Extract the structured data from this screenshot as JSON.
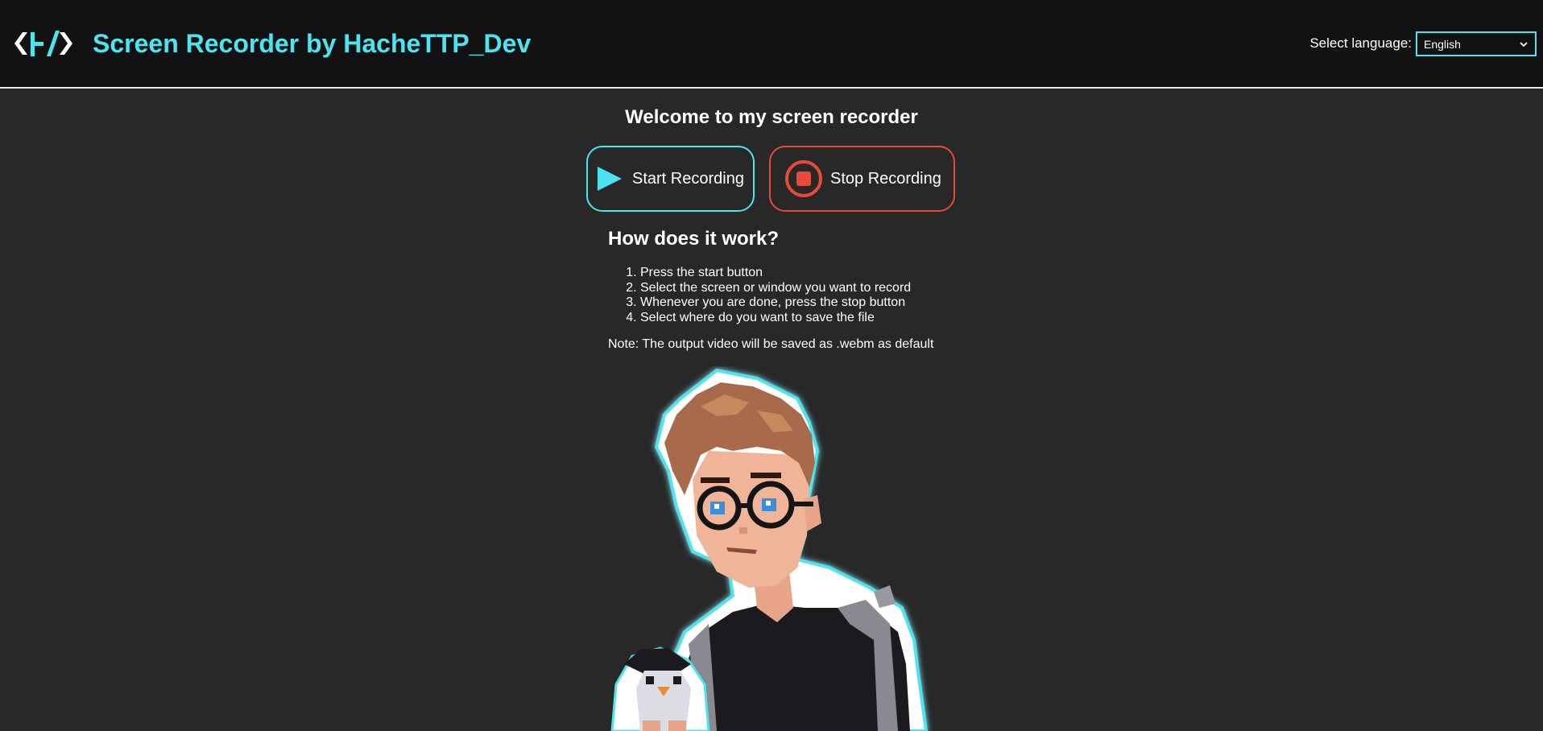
{
  "header": {
    "title": "Screen Recorder by HacheTTP_Dev",
    "language_label": "Select language:",
    "language_selected": "English",
    "accent_color": "#4de4ef"
  },
  "main": {
    "welcome": "Welcome to my screen recorder",
    "start_button": "Start Recording",
    "stop_button": "Stop Recording",
    "how_title": "How does it work?",
    "steps": [
      "Press the start button",
      "Select the screen or window you want to record",
      "Whenever you are done, press the stop button",
      "Select where do you want to save the file"
    ],
    "note": "Note: The output video will be saved as .webm as default"
  },
  "icons": {
    "logo": "hache-logo-icon",
    "start": "play-icon",
    "stop": "stop-icon",
    "select": "chevron-down-icon"
  },
  "colors": {
    "start_accent": "#4de4ef",
    "stop_accent": "#e84a3a",
    "background": "#282828",
    "header_background": "#121212"
  }
}
